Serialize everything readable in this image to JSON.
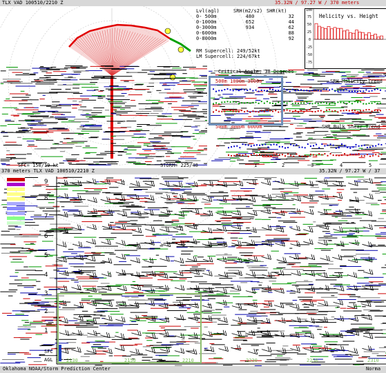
{
  "top_bar": {
    "left": "TLX VAD  100510/2210 Z",
    "right": "35.32N / 97.27 W / 370 meters"
  },
  "hodo_table": {
    "header": [
      "Lvl(agl)",
      "SRH(m2/s2)",
      "SHR(kt)"
    ],
    "rows": [
      [
        "0- 500m",
        "480",
        "32"
      ],
      [
        "0-1000m",
        "652",
        "44"
      ],
      [
        "0-3000m",
        "934",
        "62"
      ],
      [
        "0-6000m",
        "",
        "88"
      ],
      [
        "0-8000m",
        "",
        "92"
      ]
    ],
    "rm": "RM Supercell:  249/52kt",
    "lm": "LM Supercell:  224/67kt"
  },
  "helicity_chart": {
    "title": "Helicity vs. Height",
    "yticks": [
      "100",
      "75",
      "50",
      "25",
      "0",
      "-25",
      "-50",
      "-75"
    ]
  },
  "panel_labels": {
    "critical": "Critical Angle:  38 Degrees",
    "helicity_trend": "SRH Helicity Trend",
    "bulk_shear": "SHR Bulk Shear Trend",
    "layers_top": "500m 1000m 3000m",
    "layers_bottom": "500m 3000m 6000m",
    "sfc": "SFC= 150/19 kt",
    "storm": "STORM= 225/48",
    "xticks": [
      "1",
      "2",
      "3",
      "4",
      "5"
    ]
  },
  "mid_bar": {
    "left": "370 meters  TLX VAD  100510/2210 Z",
    "right": "35.32N / 97.27 W / 37"
  },
  "timeheight": {
    "yticks": [
      "9",
      "8",
      "7",
      "6",
      "5",
      "4",
      "3",
      "2",
      "1",
      "SFC",
      "AGL"
    ],
    "times": [
      "2130",
      "2150",
      "2210",
      "2230",
      "2250",
      "2310"
    ]
  },
  "bottom_bar": {
    "left": "Oklahoma   NOAA/Storm Prediction Center",
    "right": "Norma"
  }
}
